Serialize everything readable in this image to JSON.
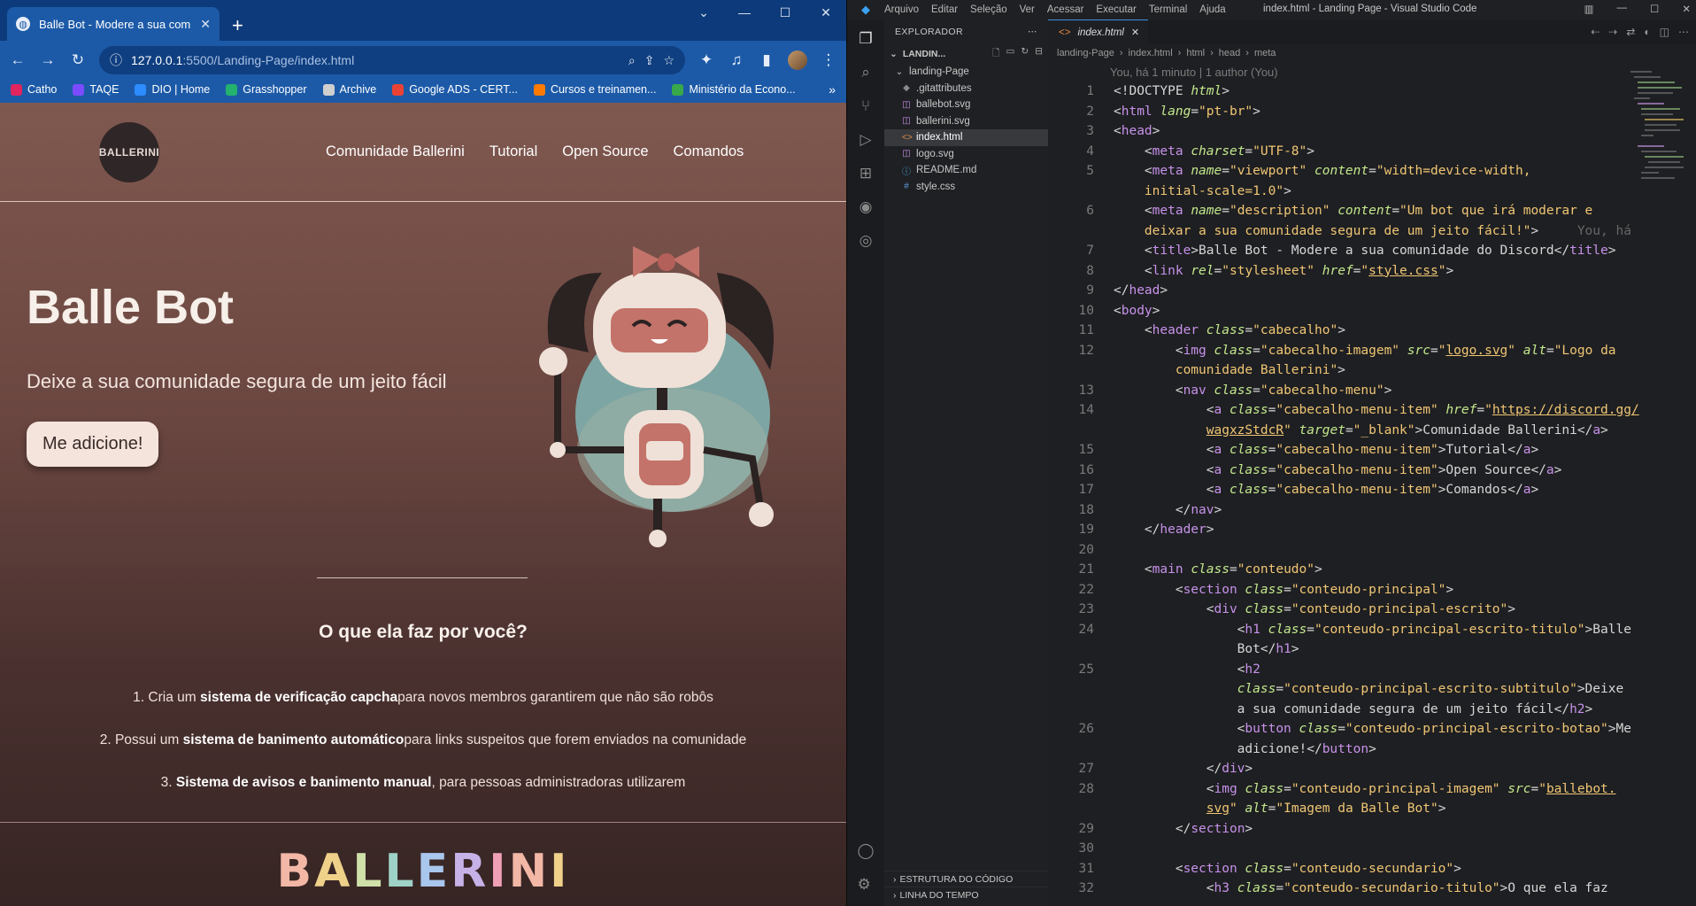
{
  "browser": {
    "tab_title": "Balle Bot - Modere a sua comuni",
    "url_host": "127.0.0.1",
    "url_path": ":5500/Landing-Page/index.html",
    "bookmarks": [
      "Catho",
      "TAQE",
      "DIO | Home",
      "Grasshopper",
      "Archive",
      "Google ADS - CERT...",
      "Cursos e treinamen...",
      "Ministério da Econo..."
    ],
    "bookmark_colors": [
      "#e0245e",
      "#7b4cff",
      "#2d8cff",
      "#23b26d",
      "#cfcfcf",
      "#ea4335",
      "#ff7a00",
      "#38a84b"
    ]
  },
  "site": {
    "logo_text": "BALLERINI",
    "menu": [
      "Comunidade Ballerini",
      "Tutorial",
      "Open Source",
      "Comandos"
    ],
    "title": "Balle Bot",
    "subtitle": "Deixe a sua comunidade segura de um jeito fácil",
    "cta": "Me adicione!",
    "section_title": "O que ela faz por você?",
    "features": [
      {
        "pre": "1. Cria um ",
        "bold": "sistema de verificação capcha",
        "post": "para novos membros garantirem que não são robôs"
      },
      {
        "pre": "2. Possui um ",
        "bold": "sistema de banimento automático",
        "post": "para links suspeitos que forem enviados na comunidade"
      },
      {
        "pre": "3. ",
        "bold": "Sistema de avisos e banimento manual",
        "post": ", para pessoas administradoras utilizarem"
      }
    ],
    "brand_letters": [
      "B",
      "A",
      "L",
      "L",
      "E",
      "R",
      "I",
      "N",
      "I"
    ],
    "brand_colors": [
      "#f3b7a6",
      "#f0d18a",
      "#cfe1a9",
      "#9fd2c7",
      "#a9c6ec",
      "#c7b2e8",
      "#ef9fb6",
      "#f3b7a6",
      "#f0d18a"
    ]
  },
  "vscode": {
    "menus": [
      "Arquivo",
      "Editar",
      "Seleção",
      "Ver",
      "Acessar",
      "Executar",
      "Terminal",
      "Ajuda"
    ],
    "window_title": "index.html - Landing Page - Visual Studio Code",
    "explorer_label": "EXPLORADOR",
    "project": "LANDIN...",
    "folder": "landing-Page",
    "files": [
      ".gitattributes",
      "ballebot.svg",
      "ballerini.svg",
      "index.html",
      "logo.svg",
      "README.md",
      "style.css"
    ],
    "outline": "ESTRUTURA DO CÓDIGO",
    "timeline": "LINHA DO TEMPO",
    "tab": "index.html",
    "breadcrumbs": [
      "landing-Page",
      "index.html",
      "html",
      "head",
      "meta"
    ],
    "blame": "You, há 1 minuto | 1 author (You)",
    "inline_blame": "You, há"
  }
}
